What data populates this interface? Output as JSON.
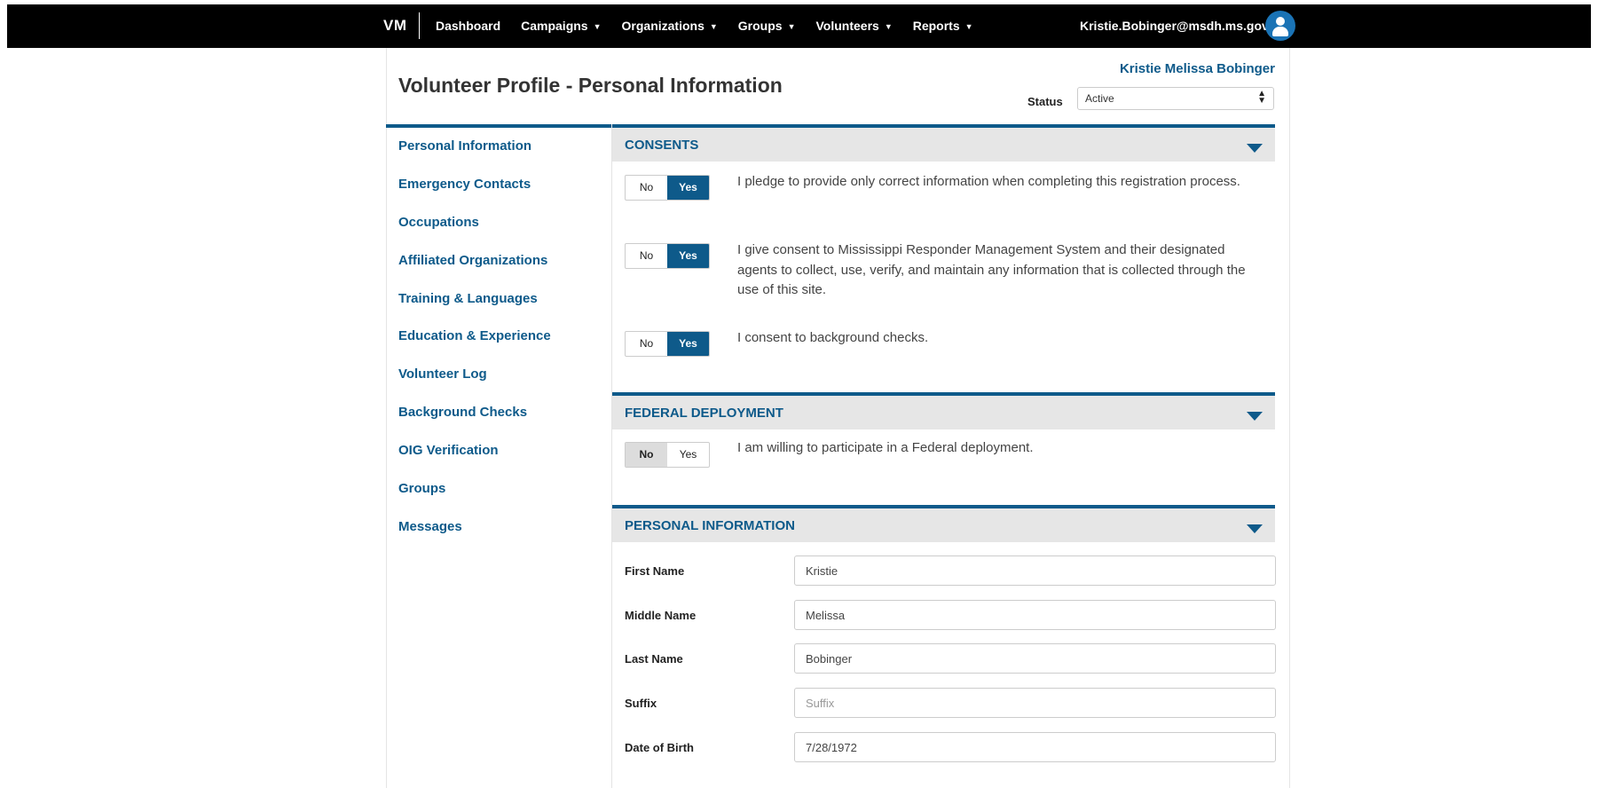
{
  "header": {
    "brand": "VM",
    "nav": [
      {
        "label": "Dashboard",
        "dropdown": false
      },
      {
        "label": "Campaigns",
        "dropdown": true
      },
      {
        "label": "Organizations",
        "dropdown": true
      },
      {
        "label": "Groups",
        "dropdown": true
      },
      {
        "label": "Volunteers",
        "dropdown": true
      },
      {
        "label": "Reports",
        "dropdown": true
      }
    ],
    "user_email": "Kristie.Bobinger@msdh.ms.gov"
  },
  "page": {
    "title": "Volunteer Profile - Personal Information",
    "profile_name": "Kristie Melissa Bobinger",
    "status_label": "Status",
    "status_value": "Active"
  },
  "sidebar": {
    "items": [
      "Personal Information",
      "Emergency Contacts",
      "Occupations",
      "Affiliated Organizations",
      "Training & Languages",
      "Education & Experience",
      "Volunteer Log",
      "Background Checks",
      "OIG Verification",
      "Groups",
      "Messages"
    ]
  },
  "consents": {
    "title": "CONSENTS",
    "items": [
      {
        "no": "No",
        "yes": "Yes",
        "selected": "Yes",
        "text": "I pledge to provide only correct information when completing this registration process."
      },
      {
        "no": "No",
        "yes": "Yes",
        "selected": "Yes",
        "text": "I give consent to Mississippi Responder Management System and their designated agents to collect, use, verify, and maintain any information that is collected through the use of this site."
      },
      {
        "no": "No",
        "yes": "Yes",
        "selected": "Yes",
        "text": "I consent to background checks."
      }
    ]
  },
  "federal": {
    "title": "FEDERAL DEPLOYMENT",
    "item": {
      "no": "No",
      "yes": "Yes",
      "selected": "No",
      "text": "I am willing to participate in a Federal deployment."
    }
  },
  "personal": {
    "title": "PERSONAL INFORMATION",
    "fields": [
      {
        "label": "First Name",
        "value": "Kristie",
        "placeholder": ""
      },
      {
        "label": "Middle Name",
        "value": "Melissa",
        "placeholder": ""
      },
      {
        "label": "Last Name",
        "value": "Bobinger",
        "placeholder": ""
      },
      {
        "label": "Suffix",
        "value": "",
        "placeholder": "Suffix"
      },
      {
        "label": "Date of Birth",
        "value": "7/28/1972",
        "placeholder": ""
      }
    ]
  },
  "icons": {
    "user": "user-icon",
    "caret": "caret-down-icon",
    "select_arrows": "sort-arrows-icon"
  }
}
